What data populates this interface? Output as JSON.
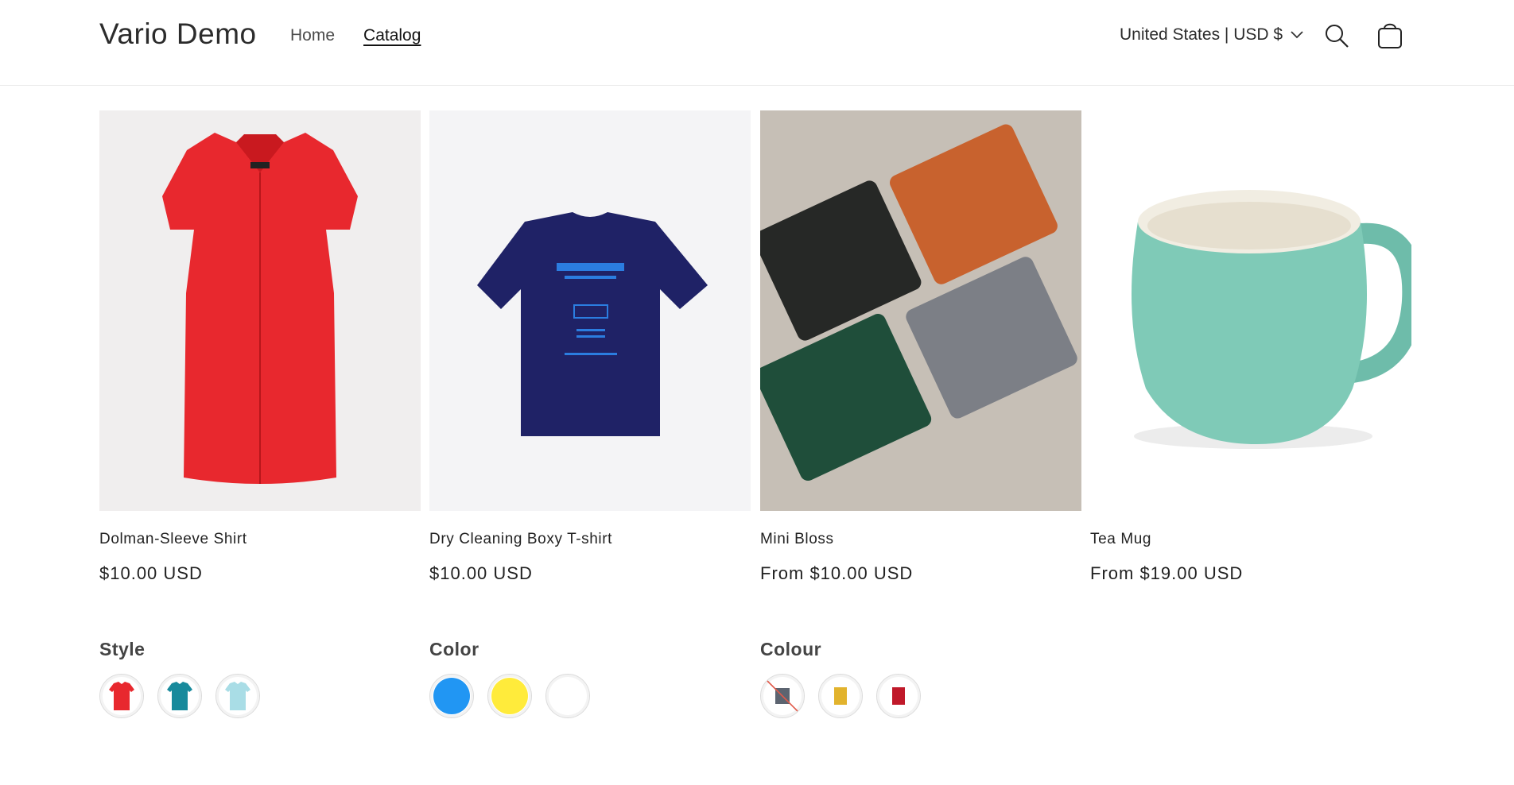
{
  "header": {
    "brand": "Vario Demo",
    "nav": [
      {
        "label": "Home"
      },
      {
        "label": "Catalog"
      }
    ],
    "locale": "United States | USD $"
  },
  "products": [
    {
      "title": "Dolman-Sleeve Shirt",
      "price": "$10.00 USD",
      "option_label": "Style",
      "swatches": [
        "red shirt",
        "teal shirt",
        "light blue shirt"
      ]
    },
    {
      "title": "Dry Cleaning Boxy T-shirt",
      "price": "$10.00 USD",
      "option_label": "Color",
      "swatches": [
        "#2196f3",
        "#ffeb3b",
        "#ffffff"
      ]
    },
    {
      "title": "Mini Bloss",
      "price": "From $10.00 USD",
      "option_label": "Colour",
      "swatches": [
        "grey wallet (unavailable)",
        "yellow wallet",
        "red wallet"
      ]
    },
    {
      "title": "Tea Mug",
      "price": "From $19.00 USD"
    }
  ],
  "colors": {
    "shirt_red": "#e8282e",
    "tshirt_navy": "#1f2266",
    "wallet_orange": "#c8622e",
    "mug_teal": "#7fcab7"
  },
  "icons": [
    "chevron-down-icon",
    "search-icon",
    "cart-icon"
  ]
}
